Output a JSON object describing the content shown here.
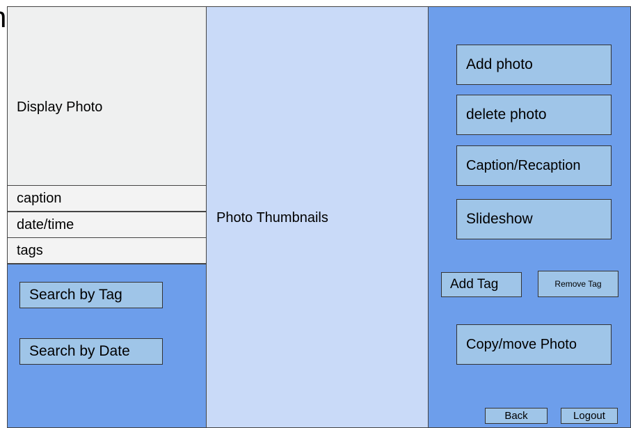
{
  "partial_heading": "n",
  "display": {
    "label": "Display Photo"
  },
  "info": {
    "caption": "caption",
    "datetime": "date/time",
    "tags": "tags"
  },
  "search": {
    "by_tag": "Search by Tag",
    "by_date": "Search by Date"
  },
  "thumbnails": {
    "label": "Photo Thumbnails"
  },
  "actions": {
    "add_photo": "Add photo",
    "delete_photo": "delete photo",
    "caption": "Caption/Recaption",
    "slideshow": "Slideshow",
    "add_tag": "Add Tag",
    "remove_tag": "Remove Tag",
    "copy_move": "Copy/move Photo",
    "back": "Back",
    "logout": "Logout"
  },
  "colors": {
    "panel_blue": "#6d9eeb",
    "button_blue": "#9fc5e8",
    "thumbnail_bg": "#c9daf8",
    "display_bg": "#eff0f0"
  }
}
